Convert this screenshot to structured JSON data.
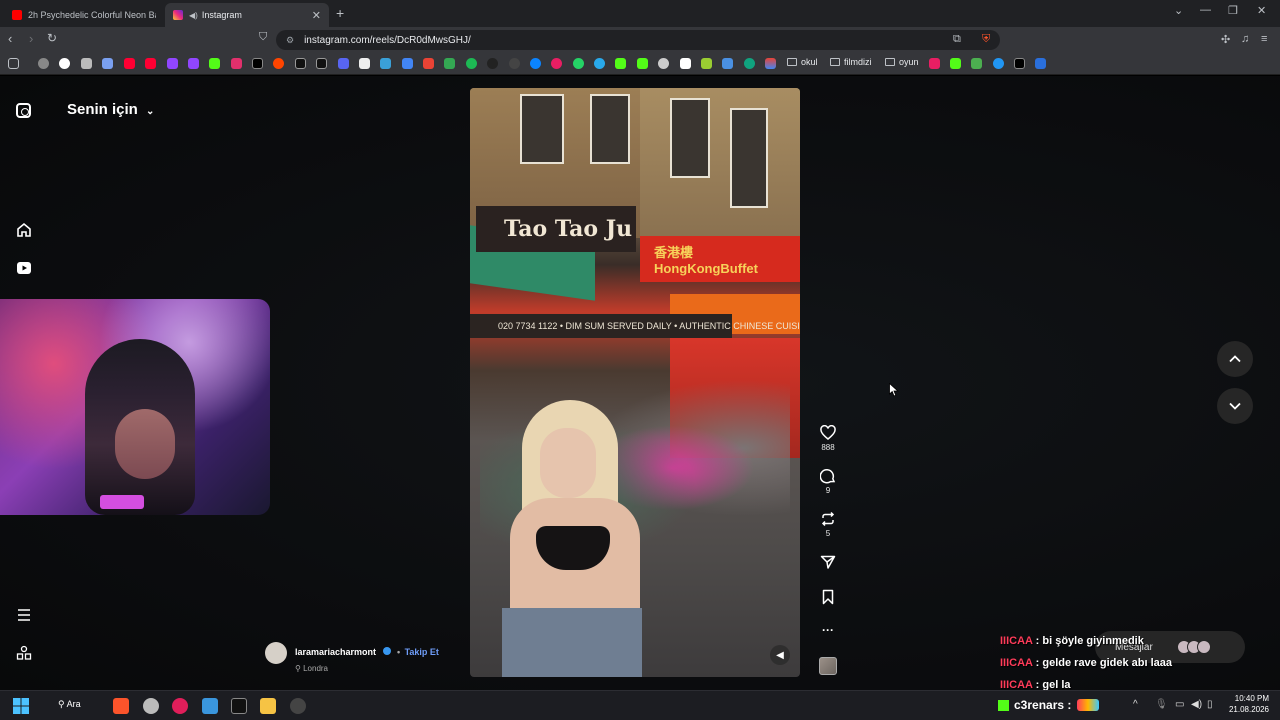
{
  "browser": {
    "tabs": [
      {
        "title": "2h Psychedelic Colorful Neon Backgr",
        "active": false
      },
      {
        "title": "Instagram",
        "active": true
      }
    ],
    "url": "instagram.com/reels/DcR0dMwsGHJ/",
    "bookmark_folders": [
      "okul",
      "filmdizi",
      "oyun"
    ]
  },
  "sidebar": {
    "feed_title": "Senin için",
    "icons": [
      "instagram-logo-icon",
      "home-icon",
      "reels-icon",
      "menu-icon",
      "more-apps-icon"
    ]
  },
  "reel": {
    "sign_main": "Tao Tao Ju",
    "sign_buffet": "香港樓 HongKongBuffet",
    "banner": "020 7734 1122 • DIM SUM SERVED DAILY • AUTHENTIC CHINESE CUISINE"
  },
  "actions": {
    "likes": "888",
    "comments": "9",
    "reposts": "5"
  },
  "author": {
    "username": "laramariacharmont",
    "follow_label": "Takip Et",
    "location": "Londra"
  },
  "messages_bar": {
    "label": "Mesajlar"
  },
  "chat": [
    {
      "user": "IIICAA",
      "text": "bi şöyle giyinmedik"
    },
    {
      "user": "IIICAA",
      "text": "gelde rave gidek abı laaa"
    },
    {
      "user": "IIICAA",
      "text": "gel la"
    }
  ],
  "stream_overlay": {
    "channel": "c3renars :"
  },
  "taskbar": {
    "search_label": "Ara",
    "time": "10:40 PM",
    "date": "21.08.2026"
  },
  "colors": {
    "accent": "#3897f0",
    "follow": "#6e9cf7",
    "chat_user": "#ff3c5a",
    "kick_green": "#53fc18"
  }
}
